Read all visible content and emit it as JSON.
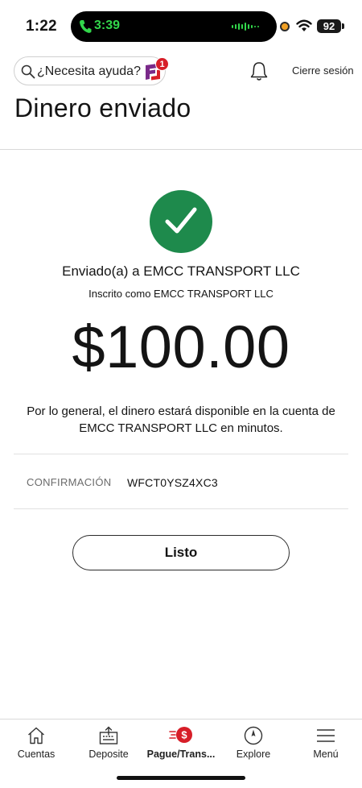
{
  "status_bar": {
    "time": "1:22",
    "call_timer": "3:39",
    "battery": "92",
    "call_color": "#32d74b",
    "dot_color": "#f0a024"
  },
  "header": {
    "search_placeholder": "¿Necesita ayuda?",
    "notification_count": "1",
    "sign_out_label": "Cierre sesión",
    "title": "Dinero enviado"
  },
  "confirmation": {
    "success_color": "#1e8a4c",
    "sent_to": "Enviado(a) a EMCC TRANSPORT LLC",
    "enrolled_as": "Inscrito como EMCC TRANSPORT LLC",
    "amount": "$100.00",
    "availability_note": "Por lo general, el dinero estará disponible en la cuenta de EMCC TRANSPORT LLC en minutos.",
    "confirmation_label": "CONFIRMACIÓN",
    "confirmation_number": "WFCT0YSZ4XC3",
    "done_label": "Listo"
  },
  "bottom_nav": {
    "items": [
      {
        "label": "Cuentas",
        "icon": "home-icon"
      },
      {
        "label": "Deposite",
        "icon": "deposit-icon"
      },
      {
        "label": "Pague/Trans...",
        "icon": "pay-transfer-icon",
        "active": true
      },
      {
        "label": "Explore",
        "icon": "compass-icon"
      },
      {
        "label": "Menú",
        "icon": "menu-icon"
      }
    ],
    "accent_color": "#d71e28"
  }
}
